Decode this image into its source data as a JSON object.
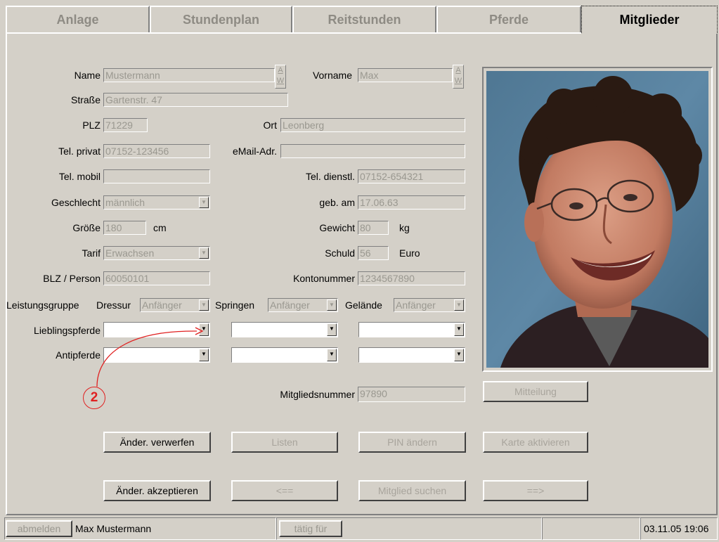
{
  "tabs": [
    {
      "label": "Anlage"
    },
    {
      "label": "Stundenplan"
    },
    {
      "label": "Reitstunden"
    },
    {
      "label": "Pferde"
    },
    {
      "label": "Mitglieder"
    }
  ],
  "form": {
    "name": {
      "label": "Name",
      "value": "Mustermann"
    },
    "vorname": {
      "label": "Vorname",
      "value": "Max"
    },
    "aw_top": "A",
    "aw_bottom": "W",
    "strasse": {
      "label": "Straße",
      "value": "Gartenstr. 47"
    },
    "plz": {
      "label": "PLZ",
      "value": "71229"
    },
    "ort": {
      "label": "Ort",
      "value": "Leonberg"
    },
    "tel_privat": {
      "label": "Tel. privat",
      "value": "07152-123456"
    },
    "email": {
      "label": "eMail-Adr.",
      "value": ""
    },
    "tel_mobil": {
      "label": "Tel. mobil",
      "value": ""
    },
    "tel_dienstl": {
      "label": "Tel. dienstl.",
      "value": "07152-654321"
    },
    "geschlecht": {
      "label": "Geschlecht",
      "value": "männlich"
    },
    "geb_am": {
      "label": "geb. am",
      "value": "17.06.63"
    },
    "groesse": {
      "label": "Größe",
      "value": "180",
      "unit": "cm"
    },
    "gewicht": {
      "label": "Gewicht",
      "value": "80",
      "unit": "kg"
    },
    "tarif": {
      "label": "Tarif",
      "value": "Erwachsen"
    },
    "schuld": {
      "label": "Schuld",
      "value": "56",
      "unit": "Euro"
    },
    "blz": {
      "label": "BLZ / Person",
      "value": "60050101"
    },
    "kontonummer": {
      "label": "Kontonummer",
      "value": "1234567890"
    },
    "leistungsgruppe": {
      "label": "Leistungsgruppe"
    },
    "dressur": {
      "label": "Dressur",
      "value": "Anfänger"
    },
    "springen": {
      "label": "Springen",
      "value": "Anfänger"
    },
    "gelaende": {
      "label": "Gelände",
      "value": "Anfänger"
    },
    "lieblingspferde": {
      "label": "Lieblingspferde"
    },
    "antipferde": {
      "label": "Antipferde"
    },
    "mitgliedsnummer": {
      "label": "Mitgliedsnummer",
      "value": "97890"
    }
  },
  "annotation": {
    "number": "2"
  },
  "buttons": {
    "mitteilung": "Mitteilung",
    "aender_verwerfen": "Änder. verwerfen",
    "listen": "Listen",
    "pin_aendern": "PIN ändern",
    "karte_aktivieren": "Karte aktivieren",
    "aender_akzeptieren": "Änder. akzeptieren",
    "prev": "<==",
    "mitglied_suchen": "Mitglied suchen",
    "next": "==>"
  },
  "statusbar": {
    "abmelden": "abmelden",
    "user": "Max Mustermann",
    "taetig_fuer": "tätig für",
    "datetime": "03.11.05  19:06"
  },
  "colors": {
    "background": "#d4d0c8",
    "annotation": "#e02020"
  }
}
